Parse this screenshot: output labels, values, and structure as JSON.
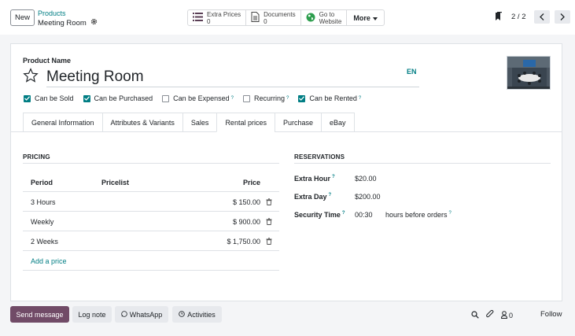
{
  "topbar": {
    "new_label": "New",
    "breadcrumb_parent": "Products",
    "breadcrumb_current": "Meeting Room",
    "smart_buttons": [
      {
        "label": "Extra Prices",
        "value": "0",
        "icon": "list-icon"
      },
      {
        "label": "Documents",
        "value": "0",
        "icon": "document-icon"
      },
      {
        "label": "Go to",
        "value": "Website",
        "icon": "globe-icon"
      }
    ],
    "more_label": "More",
    "pager": "2 / 2"
  },
  "form": {
    "product_name_label": "Product Name",
    "product_name": "Meeting Room",
    "lang": "EN",
    "checkboxes": [
      {
        "label": "Can be Sold",
        "checked": true,
        "help": false
      },
      {
        "label": "Can be Purchased",
        "checked": true,
        "help": false
      },
      {
        "label": "Can be Expensed",
        "checked": false,
        "help": true
      },
      {
        "label": "Recurring",
        "checked": false,
        "help": true
      },
      {
        "label": "Can be Rented",
        "checked": true,
        "help": true
      }
    ],
    "tabs": [
      "General Information",
      "Attributes & Variants",
      "Sales",
      "Rental prices",
      "Purchase",
      "eBay"
    ],
    "active_tab": "Rental prices"
  },
  "pricing": {
    "title": "PRICING",
    "headers": {
      "period": "Period",
      "pricelist": "Pricelist",
      "price": "Price"
    },
    "rows": [
      {
        "period": "3 Hours",
        "pricelist": "",
        "price": "$ 150.00"
      },
      {
        "period": "Weekly",
        "pricelist": "",
        "price": "$ 900.00"
      },
      {
        "period": "2 Weeks",
        "pricelist": "",
        "price": "$ 1,750.00"
      }
    ],
    "add_label": "Add a price"
  },
  "reservations": {
    "title": "RESERVATIONS",
    "extra_hour_label": "Extra Hour",
    "extra_hour": "$20.00",
    "extra_day_label": "Extra Day",
    "extra_day": "$200.00",
    "security_label": "Security Time",
    "security_value": "00:30",
    "security_suffix": "hours before orders"
  },
  "footer": {
    "send_message": "Send message",
    "log_note": "Log note",
    "whatsapp": "WhatsApp",
    "activities": "Activities",
    "followers_count": "0",
    "follow": "Follow"
  },
  "colors": {
    "accent": "#017e84",
    "brand": "#714b67"
  }
}
